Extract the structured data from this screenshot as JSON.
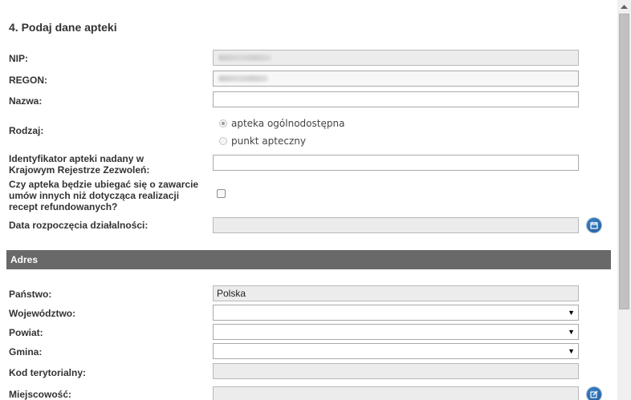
{
  "form": {
    "section_title": "4. Podaj dane apteki",
    "nip": {
      "label": "NIP:",
      "value": ""
    },
    "regon": {
      "label": "REGON:",
      "value": ""
    },
    "nazwa": {
      "label": "Nazwa:",
      "value": ""
    },
    "rodzaj": {
      "label": "Rodzaj:",
      "options": [
        "apteka ogólnodostępna",
        "punkt apteczny"
      ],
      "selected": "apteka ogólnodostępna"
    },
    "identyfikator": {
      "label_line1": "Identyfikator apteki nadany w",
      "label_line2": "Krajowym Rejestrze Zezwoleń:",
      "value": ""
    },
    "umowy": {
      "label_line1": "Czy apteka będzie ubiegać się o zawarcie",
      "label_line2": "umów innych niż dotycząca realizacji",
      "label_line3": "recept refundowanych?",
      "checked": false
    },
    "data_rozpoczecia": {
      "label": "Data rozpoczęcia działalności:",
      "value": "",
      "icon": "calendar-icon"
    }
  },
  "adres": {
    "section_label": "Adres",
    "panstwo": {
      "label": "Państwo:",
      "value": "Polska"
    },
    "wojewodztwo": {
      "label": "Województwo:",
      "value": ""
    },
    "powiat": {
      "label": "Powiat:",
      "value": ""
    },
    "gmina": {
      "label": "Gmina:",
      "value": ""
    },
    "kod_terytorialny": {
      "label": "Kod terytorialny:",
      "value": ""
    },
    "miejscowosc": {
      "label": "Miejscowość:",
      "value": "",
      "icon": "edit-icon"
    }
  },
  "colors": {
    "section_bar": "#696969",
    "button_blue": "#1d5a9a",
    "disabled_field": "#ececec"
  }
}
